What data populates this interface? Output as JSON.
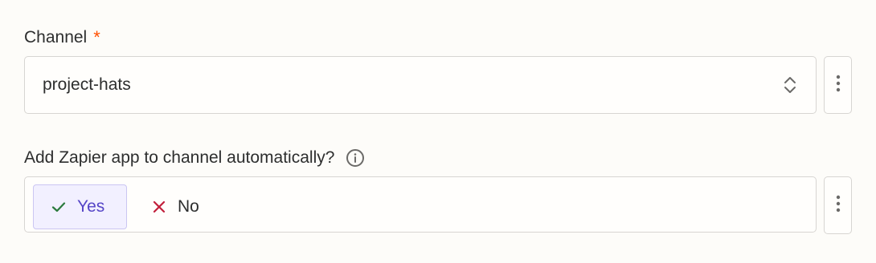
{
  "channel_field": {
    "label": "Channel",
    "required_marker": "*",
    "selected_value": "project-hats",
    "icons": {
      "chevrons": "chevron-up-down-icon",
      "more": "vertical-ellipsis-icon"
    }
  },
  "autoadd_field": {
    "label": "Add Zapier app to channel automatically?",
    "info_icon": "info-icon",
    "options": [
      {
        "label": "Yes",
        "icon": "check-icon",
        "selected": true
      },
      {
        "label": "No",
        "icon": "x-icon",
        "selected": false
      }
    ],
    "more_icon": "vertical-ellipsis-icon"
  },
  "colors": {
    "required": "#ff4f00",
    "selected_text": "#5545c7",
    "selected_bg": "#f2f0ff",
    "check": "#2b7a3d",
    "cross": "#c2203c"
  }
}
